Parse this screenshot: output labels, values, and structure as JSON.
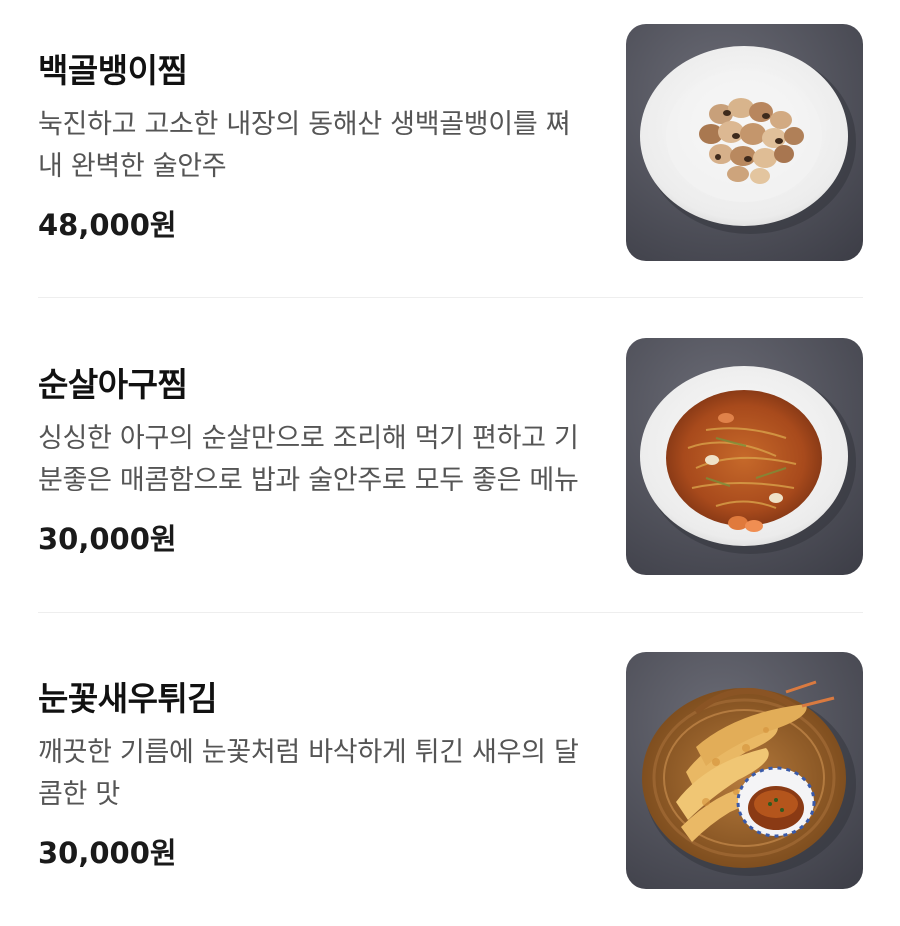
{
  "menu": {
    "items": [
      {
        "name": "백골뱅이찜",
        "description": "눅진하고 고소한 내장의 동해산 생백골뱅이를 쪄내 완벽한 술안주",
        "price": "48,000원",
        "image": "whelk-dish-photo"
      },
      {
        "name": "순살아구찜",
        "description": "싱싱한 아구의 순살만으로 조리해 먹기 편하고 기분좋은 매콤함으로 밥과 술안주로 모두 좋은 메뉴",
        "price": "30,000원",
        "image": "spicy-monkfish-dish-photo"
      },
      {
        "name": "눈꽃새우튀김",
        "description": "깨끗한 기름에 눈꽃처럼 바삭하게 튀긴 새우의 달콤한 맛",
        "price": "30,000원",
        "image": "shrimp-tempura-basket-photo"
      }
    ]
  },
  "colors": {
    "background": "#ffffff",
    "title": "#111111",
    "description": "#555555",
    "price": "#1a1a1a",
    "divider": "#eeeeee",
    "photo_backdrop": "#4a4b55"
  }
}
